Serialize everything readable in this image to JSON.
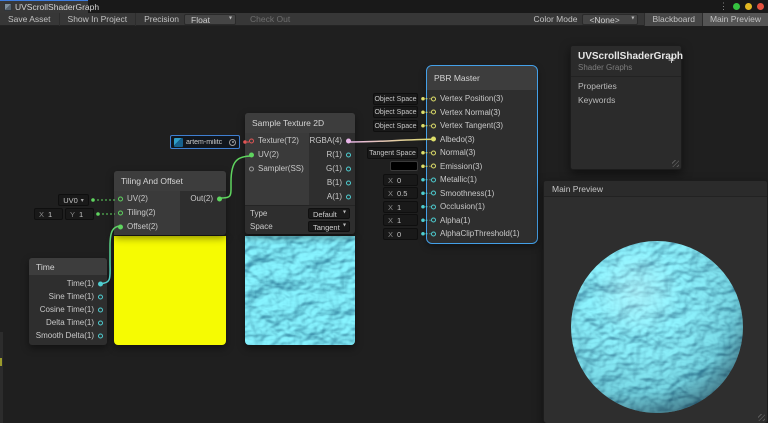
{
  "window": {
    "tab_title": "UVScrollShaderGraph"
  },
  "icons": {
    "kebab": "⋮",
    "caret": "▾",
    "plus": "+"
  },
  "window_controls": {
    "green": "#35c240",
    "yellow": "#e2b722",
    "red": "#e2513f"
  },
  "toolbar": {
    "save_asset": "Save Asset",
    "show_in_project": "Show In Project",
    "precision_label": "Precision",
    "precision_value": "Float",
    "check_out": "Check Out",
    "color_mode_label": "Color Mode",
    "color_mode_value": "<None>",
    "blackboard": "Blackboard",
    "main_preview": "Main Preview"
  },
  "nodes": {
    "time": {
      "title": "Time",
      "outputs": [
        "Time(1)",
        "Sine Time(1)",
        "Cosine Time(1)",
        "Delta Time(1)",
        "Smooth Delta(1)"
      ]
    },
    "tiling_and_offset": {
      "title": "Tiling And Offset",
      "inputs": [
        "UV(2)",
        "Tiling(2)",
        "Offset(2)"
      ],
      "output": "Out(2)",
      "uv_channel": "UV0",
      "tiling_x_label": "X",
      "tiling_x_value": "1",
      "tiling_y_label": "Y",
      "tiling_y_value": "1"
    },
    "sample_texture": {
      "title": "Sample Texture 2D",
      "inputs": [
        "Texture(T2)",
        "UV(2)",
        "Sampler(SS)"
      ],
      "outputs": [
        "RGBA(4)",
        "R(1)",
        "G(1)",
        "B(1)",
        "A(1)"
      ],
      "type_label": "Type",
      "type_value": "Default",
      "space_label": "Space",
      "space_value": "Tangent"
    },
    "texture_property": {
      "name": "artem-militc"
    },
    "pbr_master": {
      "title": "PBR Master",
      "rows": [
        {
          "label": "Vertex Position(3)",
          "widget": "Object Space"
        },
        {
          "label": "Vertex Normal(3)",
          "widget": "Object Space"
        },
        {
          "label": "Vertex Tangent(3)",
          "widget": "Object Space"
        },
        {
          "label": "Albedo(3)"
        },
        {
          "label": "Normal(3)",
          "widget": "Tangent Space"
        },
        {
          "label": "Emission(3)",
          "widget_color": "#000000"
        },
        {
          "label": "Metallic(1)",
          "x_label": "X",
          "value": "0"
        },
        {
          "label": "Smoothness(1)",
          "x_label": "X",
          "value": "0.5"
        },
        {
          "label": "Occlusion(1)",
          "x_label": "X",
          "value": "1"
        },
        {
          "label": "Alpha(1)",
          "x_label": "X",
          "value": "1"
        },
        {
          "label": "AlphaClipThreshold(1)",
          "x_label": "X",
          "value": "0"
        }
      ]
    }
  },
  "blackboard": {
    "title": "UVScrollShaderGraph",
    "subtitle": "Shader Graphs",
    "add_label": "+",
    "section_properties": "Properties",
    "section_keywords": "Keywords"
  },
  "main_preview": {
    "title": "Main Preview"
  },
  "colors": {
    "selection": "#44a0e8",
    "port_vector1": "#4ecdd1",
    "port_vector2": "#5fd45f",
    "port_vector3": "#dede6a",
    "port_vector4": "#eab6ea",
    "port_texture": "#e25555",
    "preview_yellow": "#f6fb02",
    "water_base": "#0c6e93",
    "water_caustic": "#7fe6f2"
  }
}
